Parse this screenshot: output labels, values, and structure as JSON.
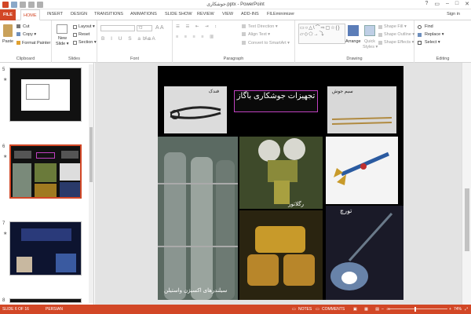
{
  "window": {
    "title": "جوشکاری.pptx - PowerPoint",
    "controls": [
      "?",
      "▭",
      "–",
      "□",
      "✕"
    ]
  },
  "tabs": {
    "file": "FILE",
    "home": "HOME",
    "insert": "INSERT",
    "design": "DESIGN",
    "transitions": "TRANSITIONS",
    "animations": "ANIMATIONS",
    "slideshow": "SLIDE SHOW",
    "review": "REVIEW",
    "view": "VIEW",
    "addins": "ADD-INS",
    "fileminimizer": "FILEminimizer",
    "signin": "Sign in"
  },
  "clipboard": {
    "paste": "Paste",
    "cut": "Cut",
    "copy": "Copy ▾",
    "format_painter": "Format Painter",
    "label": "Clipboard"
  },
  "slides": {
    "new_slide": "New",
    "new_slide2": "Slide ▾",
    "layout": "Layout ▾",
    "reset": "Reset",
    "section": "Section ▾",
    "label": "Slides"
  },
  "font": {
    "size": "72",
    "label": "Font"
  },
  "paragraph": {
    "text_direction": "Text Direction ▾",
    "align_text": "Align Text ▾",
    "smartart": "Convert to SmartArt ▾",
    "label": "Paragraph"
  },
  "drawing": {
    "arrange": "Arrange",
    "quick_styles": "Quick",
    "quick_styles2": "Styles ▾",
    "shape_fill": "Shape Fill ▾",
    "shape_outline": "Shape Outline ▾",
    "shape_effects": "Shape Effects ▾",
    "label": "Drawing"
  },
  "editing": {
    "find": "Find",
    "replace": "Replace ▾",
    "select": "Select ▾",
    "label": "Editing"
  },
  "thumbnails": [
    {
      "num": "5"
    },
    {
      "num": "6"
    },
    {
      "num": "7"
    },
    {
      "num": "8"
    }
  ],
  "slide": {
    "title": "تجهیزات جوشکاری باگاز",
    "labels": {
      "tongs": "فندک",
      "wire": "سیم جوش",
      "regulator": "رگلاتور",
      "torch": "تورچ",
      "cylinders": "سیلندرهای اکسیژن واستیلن"
    }
  },
  "status": {
    "slide": "SLIDE 6 OF 16",
    "language": "PERSIAN",
    "notes": "NOTES",
    "comments": "COMMENTS",
    "zoom": "74%"
  }
}
